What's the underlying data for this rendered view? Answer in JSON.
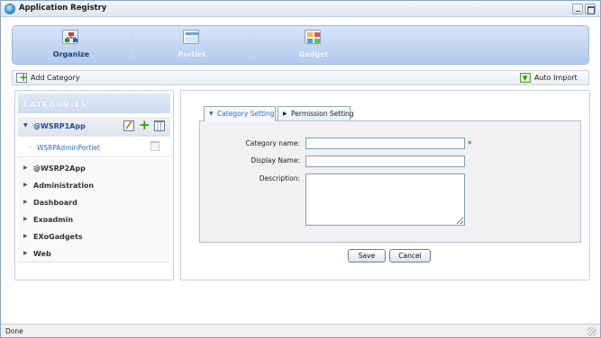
{
  "window": {
    "title": "Application Registry"
  },
  "nav": {
    "items": [
      {
        "label": "Organize",
        "icon": "organize-icon",
        "active": true
      },
      {
        "label": "Portlet",
        "icon": "portlet-icon",
        "active": false
      },
      {
        "label": "Gadget",
        "icon": "gadget-icon",
        "active": false
      }
    ]
  },
  "actions": {
    "add_category": "Add Category",
    "auto_import": "Auto Import"
  },
  "categories": {
    "header": "CATEGORIES",
    "items": [
      {
        "label": "@WSRP1App",
        "expanded": true
      },
      {
        "label": "@WSRP2App"
      },
      {
        "label": "Administration"
      },
      {
        "label": "Dashboard"
      },
      {
        "label": "Exoadmin"
      },
      {
        "label": "EXoGadgets"
      },
      {
        "label": "Web"
      }
    ],
    "portlets": [
      {
        "label": "WSRPAdminPortlet"
      }
    ]
  },
  "tabs": [
    {
      "label": "Category Setting",
      "active": true
    },
    {
      "label": "Permission Setting",
      "active": false
    }
  ],
  "form": {
    "category_name_label": "Category name:",
    "display_name_label": "Display Name:",
    "description_label": "Description:",
    "required_mark": "*",
    "category_name_value": "",
    "display_name_value": "",
    "description_value": ""
  },
  "buttons": {
    "save": "Save",
    "cancel": "Cancel"
  },
  "status": {
    "text": "Done"
  },
  "colors": {
    "accent": "#2b6fc6",
    "nav_bg": "#b3cbee",
    "add_green": "#2f9a1d"
  }
}
